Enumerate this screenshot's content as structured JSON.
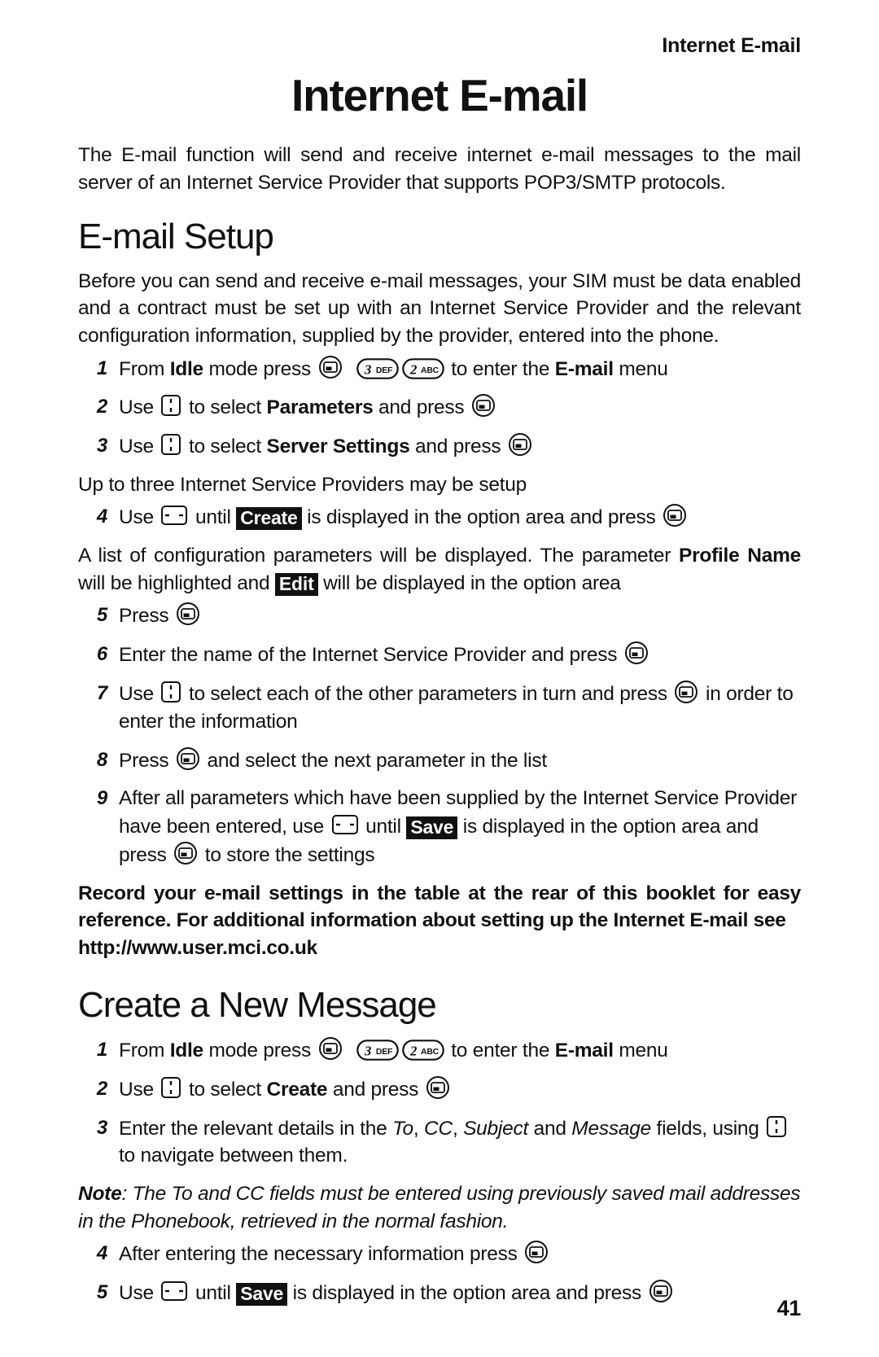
{
  "header": {
    "running_title": "Internet E-mail"
  },
  "title": "Internet E-mail",
  "intro": "The E-mail function will send and receive internet e-mail messages to the mail server of an Internet Service Provider that supports POP3/SMTP protocols.",
  "sections": [
    {
      "heading": "E-mail Setup",
      "intro": "Before you can send and receive e-mail messages, your SIM must be data enabled and a contract must be set up with an Internet Service Provider and the relevant configuration information, supplied by the provider, entered into the phone.",
      "steps": {
        "s1": {
          "num": "1",
          "t1": "From ",
          "b1": "Idle",
          "t2": " mode press ",
          "t3": " to enter the ",
          "b2": "E-mail",
          "t4": " menu"
        },
        "s2": {
          "num": "2",
          "t1": "Use ",
          "t2": " to select ",
          "b1": "Parameters",
          "t3": " and press "
        },
        "s3": {
          "num": "3",
          "t1": "Use ",
          "t2": " to select ",
          "b1": "Server Settings",
          "t3": " and press "
        },
        "s4": {
          "num": "4",
          "t1": "Use ",
          "t2": " until ",
          "inv": "Create",
          "t3": " is displayed in the option area and press "
        },
        "s5": {
          "num": "5",
          "t1": "Press "
        },
        "s6": {
          "num": "6",
          "t1": "Enter the name of the Internet Service Provider and press "
        },
        "s7": {
          "num": "7",
          "t1": "Use ",
          "t2": " to select each of the other parameters in turn and press ",
          "t3": " in order to enter the information"
        },
        "s8": {
          "num": "8",
          "t1": "Press ",
          "t2": " and select the next parameter in the list"
        },
        "s9": {
          "num": "9",
          "t1": "After all parameters which have been supplied by the Internet Service Provider have been entered, use ",
          "t2": " until ",
          "inv": "Save",
          "t3": " is displayed in the option area and press ",
          "t4": " to store the settings"
        }
      },
      "mid_note": "Up to three Internet Service Providers may be setup",
      "param_note": {
        "t1": "A list of configuration parameters will be displayed. The parameter ",
        "b1": "Profile Name",
        "t2": " will be highlighted and ",
        "inv": "Edit",
        "t3": " will be displayed in the option area"
      },
      "record_note": {
        "line1": "Record your e-mail settings in the table at the rear of this booklet for easy reference. For additional information about setting up the Internet E-mail see",
        "url": "http://www.user.mci.co.uk"
      }
    },
    {
      "heading": "Create a New Message",
      "steps": {
        "s1": {
          "num": "1",
          "t1": "From ",
          "b1": "Idle",
          "t2": " mode press ",
          "t3": " to enter the ",
          "b2": "E-mail",
          "t4": " menu"
        },
        "s2": {
          "num": "2",
          "t1": "Use ",
          "t2": " to select ",
          "b1": "Create",
          "t3": " and press "
        },
        "s3": {
          "num": "3",
          "t1": "Enter the relevant details in the ",
          "i1": "To",
          "t2": ", ",
          "i2": "CC",
          "t3": ", ",
          "i3": "Subject",
          "t4": " and ",
          "i4": "Message",
          "t5": " fields, using ",
          "t6": " to navigate between them."
        },
        "s4": {
          "num": "4",
          "t1": "After entering the necessary information press "
        },
        "s5": {
          "num": "5",
          "t1": "Use ",
          "t2": " until ",
          "inv": "Save",
          "t3": " is displayed in the option area and press "
        }
      },
      "note": {
        "label": "Note",
        "text": ": The To and CC fields must be entered using previously saved mail addresses in the Phonebook, retrieved in the normal fashion."
      }
    }
  ],
  "keys": {
    "select": "select-key-icon",
    "nav_vertical": "nav-up-down-key-icon",
    "nav_horizontal": "nav-left-right-key-icon",
    "key3": "3 DEF",
    "key2": "2 ABC"
  },
  "page_number": "41",
  "colors": {
    "text": "#111111",
    "invert_bg": "#111111",
    "invert_fg": "#ffffff",
    "page_bg": "#ffffff"
  }
}
